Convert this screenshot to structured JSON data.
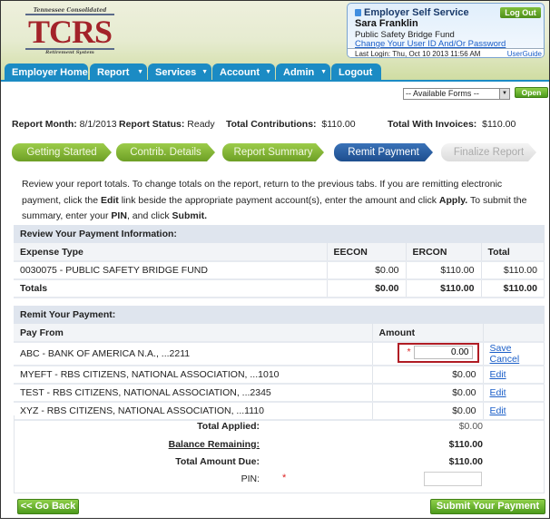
{
  "logo": {
    "top": "Tennessee Consolidated",
    "name": "TCRS",
    "bottom": "Retirement System"
  },
  "login": {
    "title": "Employer Self Service",
    "user": "Sara Franklin",
    "fund": "Public Safety Bridge Fund",
    "change_link": "Change Your User ID And/Or Password",
    "last_login": "Last Login: Thu, Oct 10 2013 11:56 AM",
    "user_guide": "UserGuide",
    "logout": "Log Out"
  },
  "nav": [
    "Employer Home",
    "Report",
    "Services",
    "Account",
    "Admin",
    "Logout"
  ],
  "forms": {
    "selected": "-- Available Forms --",
    "open": "Open"
  },
  "info": {
    "month_label": "Report Month:",
    "month": "8/1/2013",
    "status_label": "Report Status:",
    "status": "Ready",
    "contrib_label": "Total Contributions:",
    "contrib": "$110.00",
    "invoices_label": "Total With Invoices:",
    "invoices": "$110.00"
  },
  "steps": [
    {
      "label": "Getting Started",
      "state": "done"
    },
    {
      "label": "Contrib. Details",
      "state": "done"
    },
    {
      "label": "Report Summary",
      "state": "done"
    },
    {
      "label": "Remit Payment",
      "state": "active"
    },
    {
      "label": "Finalize Report",
      "state": "disabled"
    }
  ],
  "instructions": {
    "p1": "Review your report totals. To change totals on the report, return to the previous tabs. If you are remitting electronic payment, click the ",
    "edit": "Edit",
    "p2": " link beside the appropriate payment account(s), enter the amount and click ",
    "apply": "Apply.",
    "p3": " To submit the summary, enter your ",
    "pin": "PIN",
    "p4": ", and click ",
    "submit": "Submit."
  },
  "review": {
    "title": "Review Your Payment Information:",
    "columns": [
      "Expense Type",
      "EECON",
      "ERCON",
      "Total"
    ],
    "rows": [
      [
        "0030075 - PUBLIC SAFETY BRIDGE FUND",
        "$0.00",
        "$110.00",
        "$110.00"
      ]
    ],
    "totals": [
      "Totals",
      "$0.00",
      "$110.00",
      "$110.00"
    ]
  },
  "remit": {
    "title": "Remit Your Payment:",
    "columns": [
      "Pay From",
      "Amount"
    ],
    "editing": {
      "account": "ABC - BANK OF AMERICA N.A., ...2211",
      "amount": "0.00",
      "save": "Save",
      "cancel": "Cancel"
    },
    "rows": [
      {
        "account": "MYEFT - RBS CITIZENS, NATIONAL ASSOCIATION, ...1010",
        "amount": "$0.00",
        "action": "Edit"
      },
      {
        "account": "TEST - RBS CITIZENS, NATIONAL ASSOCIATION, ...2345",
        "amount": "$0.00",
        "action": "Edit"
      },
      {
        "account": "XYZ - RBS CITIZENS, NATIONAL ASSOCIATION, ...1110",
        "amount": "$0.00",
        "action": "Edit"
      }
    ]
  },
  "summary": {
    "applied_label": "Total Applied:",
    "applied": "$0.00",
    "balance_label": "Balance Remaining:",
    "balance": "$110.00",
    "due_label": "Total Amount Due:",
    "due": "$110.00",
    "pin_label": "PIN:",
    "pin_value": "",
    "required": "*"
  },
  "buttons": {
    "back": "<< Go Back",
    "submit": "Submit Your Payment >>"
  },
  "colors": {
    "nav": "#1b8bc4",
    "step_done": "#7fae30",
    "step_active": "#2a5fa3",
    "highlight": "#b01c24"
  }
}
